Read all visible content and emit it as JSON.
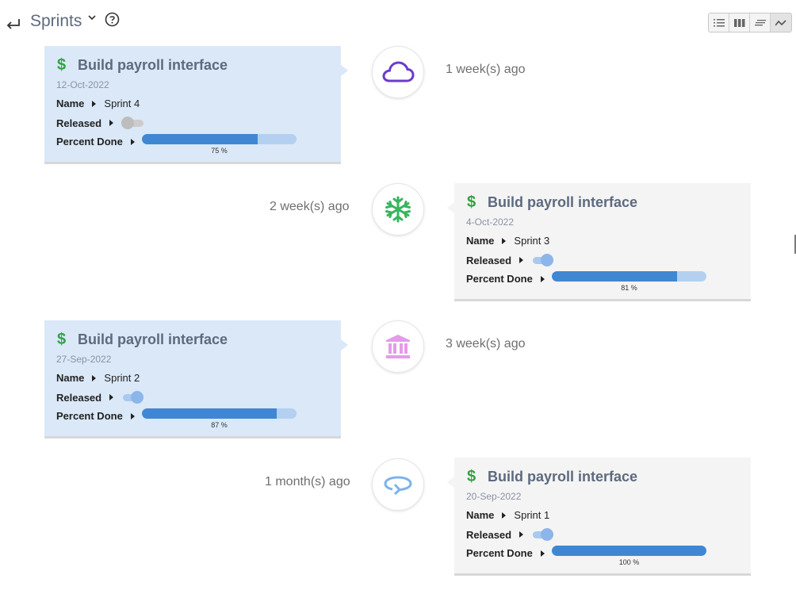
{
  "header": {
    "title": "Sprints",
    "back_icon": "back-arrow-icon",
    "caret_icon": "chevron-down-icon",
    "help_icon": "help-circle-icon",
    "views": [
      {
        "name": "list-view-icon",
        "active": false
      },
      {
        "name": "column-view-icon",
        "active": false
      },
      {
        "name": "text-view-icon",
        "active": false
      },
      {
        "name": "timeline-view-icon",
        "active": true
      }
    ]
  },
  "labels": {
    "name": "Name",
    "released": "Released",
    "percent_done": "Percent Done"
  },
  "colors": {
    "accent": "#3f87d2",
    "dollar": "#31a341",
    "card_left_bg": "#dae8f8",
    "card_right_bg": "#f4f4f4"
  },
  "timeline": [
    {
      "title": "Build payroll interface",
      "date": "12-Oct-2022",
      "name_value": "Sprint 4",
      "released": false,
      "percent": 75,
      "percent_label": "75 %",
      "ago": "1 week(s) ago",
      "icon": "cloud-icon",
      "icon_color": "#6b3ccc",
      "side": "left"
    },
    {
      "title": "Build payroll interface",
      "date": "4-Oct-2022",
      "name_value": "Sprint 3",
      "released": true,
      "percent": 81,
      "percent_label": "81 %",
      "ago": "2 week(s) ago",
      "icon": "snowflake-icon",
      "icon_color": "#37b55d",
      "side": "right"
    },
    {
      "title": "Build payroll interface",
      "date": "27-Sep-2022",
      "name_value": "Sprint 2",
      "released": true,
      "percent": 87,
      "percent_label": "87 %",
      "ago": "3 week(s) ago",
      "icon": "bank-icon",
      "icon_color": "#e59bea",
      "side": "left"
    },
    {
      "title": "Build payroll interface",
      "date": "20-Sep-2022",
      "name_value": "Sprint 1",
      "released": true,
      "percent": 100,
      "percent_label": "100 %",
      "ago": "1 month(s) ago",
      "icon": "rotate-arrow-icon",
      "icon_color": "#7db3ec",
      "side": "right"
    }
  ]
}
